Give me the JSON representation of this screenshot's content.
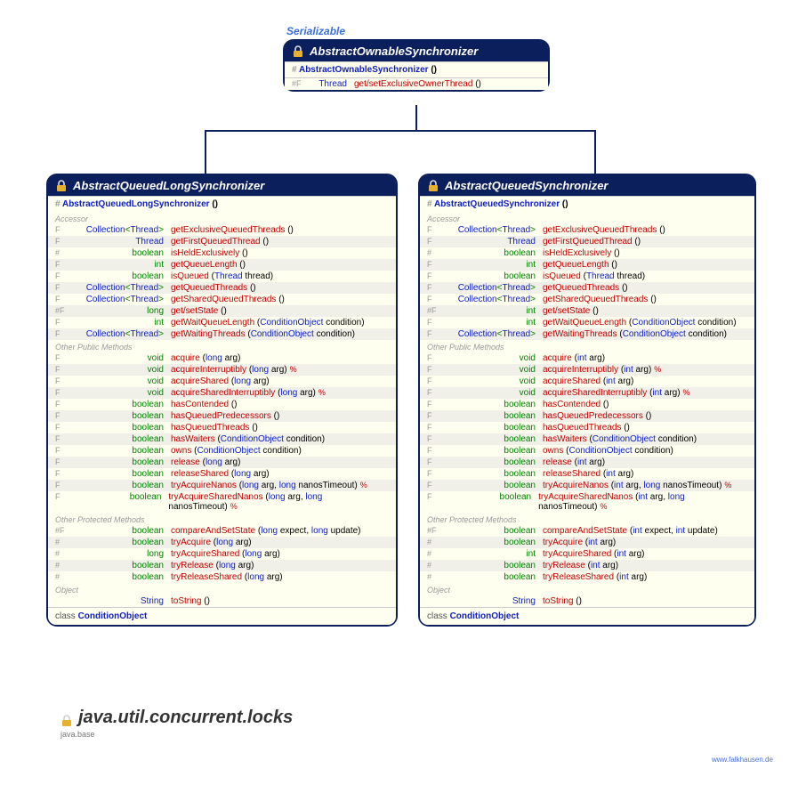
{
  "iface": "Serializable",
  "top": {
    "title": "AbstractOwnableSynchronizer",
    "ctor": "AbstractOwnableSynchronizer",
    "r": [
      {
        "m": "#F",
        "t": "Thread",
        "n": "get/setExclusiveOwnerThread",
        "p": "()"
      }
    ]
  },
  "left": {
    "title": "AbstractQueuedLongSynchronizer",
    "ctor": "AbstractQueuedLongSynchronizer",
    "g": [
      {
        "h": "Accessor",
        "r": [
          {
            "m": "F",
            "t": "Collection<Thread>",
            "n": "getExclusiveQueuedThreads",
            "p": "()"
          },
          {
            "m": "F",
            "t": "Thread",
            "n": "getFirstQueuedThread",
            "p": "()"
          },
          {
            "m": "#",
            "t": "boolean",
            "n": "isHeldExclusively",
            "p": "()"
          },
          {
            "m": "F",
            "t": "int",
            "n": "getQueueLength",
            "p": "()"
          },
          {
            "m": "F",
            "t": "boolean",
            "n": "isQueued",
            "p": "(Thread thread)"
          },
          {
            "m": "F",
            "t": "Collection<Thread>",
            "n": "getQueuedThreads",
            "p": "()"
          },
          {
            "m": "F",
            "t": "Collection<Thread>",
            "n": "getSharedQueuedThreads",
            "p": "()"
          },
          {
            "m": "#F",
            "t": "long",
            "n": "get/setState",
            "p": "()"
          },
          {
            "m": "F",
            "t": "int",
            "n": "getWaitQueueLength",
            "p": "(ConditionObject condition)"
          },
          {
            "m": "F",
            "t": "Collection<Thread>",
            "n": "getWaitingThreads",
            "p": "(ConditionObject condition)"
          }
        ]
      },
      {
        "h": "Other Public Methods",
        "r": [
          {
            "m": "F",
            "t": "void",
            "n": "acquire",
            "p": "(long arg)"
          },
          {
            "m": "F",
            "t": "void",
            "n": "acquireInterruptibly",
            "p": "(long arg)",
            "e": "%"
          },
          {
            "m": "F",
            "t": "void",
            "n": "acquireShared",
            "p": "(long arg)"
          },
          {
            "m": "F",
            "t": "void",
            "n": "acquireSharedInterruptibly",
            "p": "(long arg)",
            "e": "%"
          },
          {
            "m": "F",
            "t": "boolean",
            "n": "hasContended",
            "p": "()"
          },
          {
            "m": "F",
            "t": "boolean",
            "n": "hasQueuedPredecessors",
            "p": "()"
          },
          {
            "m": "F",
            "t": "boolean",
            "n": "hasQueuedThreads",
            "p": "()"
          },
          {
            "m": "F",
            "t": "boolean",
            "n": "hasWaiters",
            "p": "(ConditionObject condition)"
          },
          {
            "m": "F",
            "t": "boolean",
            "n": "owns",
            "p": "(ConditionObject condition)"
          },
          {
            "m": "F",
            "t": "boolean",
            "n": "release",
            "p": "(long arg)"
          },
          {
            "m": "F",
            "t": "boolean",
            "n": "releaseShared",
            "p": "(long arg)"
          },
          {
            "m": "F",
            "t": "boolean",
            "n": "tryAcquireNanos",
            "p": "(long arg, long nanosTimeout)",
            "e": "%"
          },
          {
            "m": "F",
            "t": "boolean",
            "n": "tryAcquireSharedNanos",
            "p": "(long arg, long nanosTimeout)",
            "e": "%"
          }
        ]
      },
      {
        "h": "Other Protected Methods",
        "r": [
          {
            "m": "#F",
            "t": "boolean",
            "n": "compareAndSetState",
            "p": "(long expect, long update)"
          },
          {
            "m": "#",
            "t": "boolean",
            "n": "tryAcquire",
            "p": "(long arg)"
          },
          {
            "m": "#",
            "t": "long",
            "n": "tryAcquireShared",
            "p": "(long arg)"
          },
          {
            "m": "#",
            "t": "boolean",
            "n": "tryRelease",
            "p": "(long arg)"
          },
          {
            "m": "#",
            "t": "boolean",
            "n": "tryReleaseShared",
            "p": "(long arg)"
          }
        ]
      },
      {
        "h": "Object",
        "r": [
          {
            "m": "",
            "t": "String",
            "n": "toString",
            "p": "()"
          }
        ]
      }
    ],
    "foot": {
      "pre": "class ",
      "cl": "ConditionObject"
    }
  },
  "right": {
    "title": "AbstractQueuedSynchronizer",
    "ctor": "AbstractQueuedSynchronizer",
    "g": [
      {
        "h": "Accessor",
        "r": [
          {
            "m": "F",
            "t": "Collection<Thread>",
            "n": "getExclusiveQueuedThreads",
            "p": "()"
          },
          {
            "m": "F",
            "t": "Thread",
            "n": "getFirstQueuedThread",
            "p": "()"
          },
          {
            "m": "#",
            "t": "boolean",
            "n": "isHeldExclusively",
            "p": "()"
          },
          {
            "m": "F",
            "t": "int",
            "n": "getQueueLength",
            "p": "()"
          },
          {
            "m": "F",
            "t": "boolean",
            "n": "isQueued",
            "p": "(Thread thread)"
          },
          {
            "m": "F",
            "t": "Collection<Thread>",
            "n": "getQueuedThreads",
            "p": "()"
          },
          {
            "m": "F",
            "t": "Collection<Thread>",
            "n": "getSharedQueuedThreads",
            "p": "()"
          },
          {
            "m": "#F",
            "t": "int",
            "n": "get/setState",
            "p": "()"
          },
          {
            "m": "F",
            "t": "int",
            "n": "getWaitQueueLength",
            "p": "(ConditionObject condition)"
          },
          {
            "m": "F",
            "t": "Collection<Thread>",
            "n": "getWaitingThreads",
            "p": "(ConditionObject condition)"
          }
        ]
      },
      {
        "h": "Other Public Methods",
        "r": [
          {
            "m": "F",
            "t": "void",
            "n": "acquire",
            "p": "(int arg)"
          },
          {
            "m": "F",
            "t": "void",
            "n": "acquireInterruptibly",
            "p": "(int arg)",
            "e": "%"
          },
          {
            "m": "F",
            "t": "void",
            "n": "acquireShared",
            "p": "(int arg)"
          },
          {
            "m": "F",
            "t": "void",
            "n": "acquireSharedInterruptibly",
            "p": "(int arg)",
            "e": "%"
          },
          {
            "m": "F",
            "t": "boolean",
            "n": "hasContended",
            "p": "()"
          },
          {
            "m": "F",
            "t": "boolean",
            "n": "hasQueuedPredecessors",
            "p": "()"
          },
          {
            "m": "F",
            "t": "boolean",
            "n": "hasQueuedThreads",
            "p": "()"
          },
          {
            "m": "F",
            "t": "boolean",
            "n": "hasWaiters",
            "p": "(ConditionObject condition)"
          },
          {
            "m": "F",
            "t": "boolean",
            "n": "owns",
            "p": "(ConditionObject condition)"
          },
          {
            "m": "F",
            "t": "boolean",
            "n": "release",
            "p": "(int arg)"
          },
          {
            "m": "F",
            "t": "boolean",
            "n": "releaseShared",
            "p": "(int arg)"
          },
          {
            "m": "F",
            "t": "boolean",
            "n": "tryAcquireNanos",
            "p": "(int arg, long nanosTimeout)",
            "e": "%"
          },
          {
            "m": "F",
            "t": "boolean",
            "n": "tryAcquireSharedNanos",
            "p": "(int arg, long nanosTimeout)",
            "e": "%"
          }
        ]
      },
      {
        "h": "Other Protected Methods",
        "r": [
          {
            "m": "#F",
            "t": "boolean",
            "n": "compareAndSetState",
            "p": "(int expect, int update)"
          },
          {
            "m": "#",
            "t": "boolean",
            "n": "tryAcquire",
            "p": "(int arg)"
          },
          {
            "m": "#",
            "t": "int",
            "n": "tryAcquireShared",
            "p": "(int arg)"
          },
          {
            "m": "#",
            "t": "boolean",
            "n": "tryRelease",
            "p": "(int arg)"
          },
          {
            "m": "#",
            "t": "boolean",
            "n": "tryReleaseShared",
            "p": "(int arg)"
          }
        ]
      },
      {
        "h": "Object",
        "r": [
          {
            "m": "",
            "t": "String",
            "n": "toString",
            "p": "()"
          }
        ]
      }
    ],
    "foot": {
      "pre": "class ",
      "cl": "ConditionObject"
    }
  },
  "pkg": "java.util.concurrent.locks",
  "mbase": "java.base",
  "url": "www.falkhausen.de"
}
